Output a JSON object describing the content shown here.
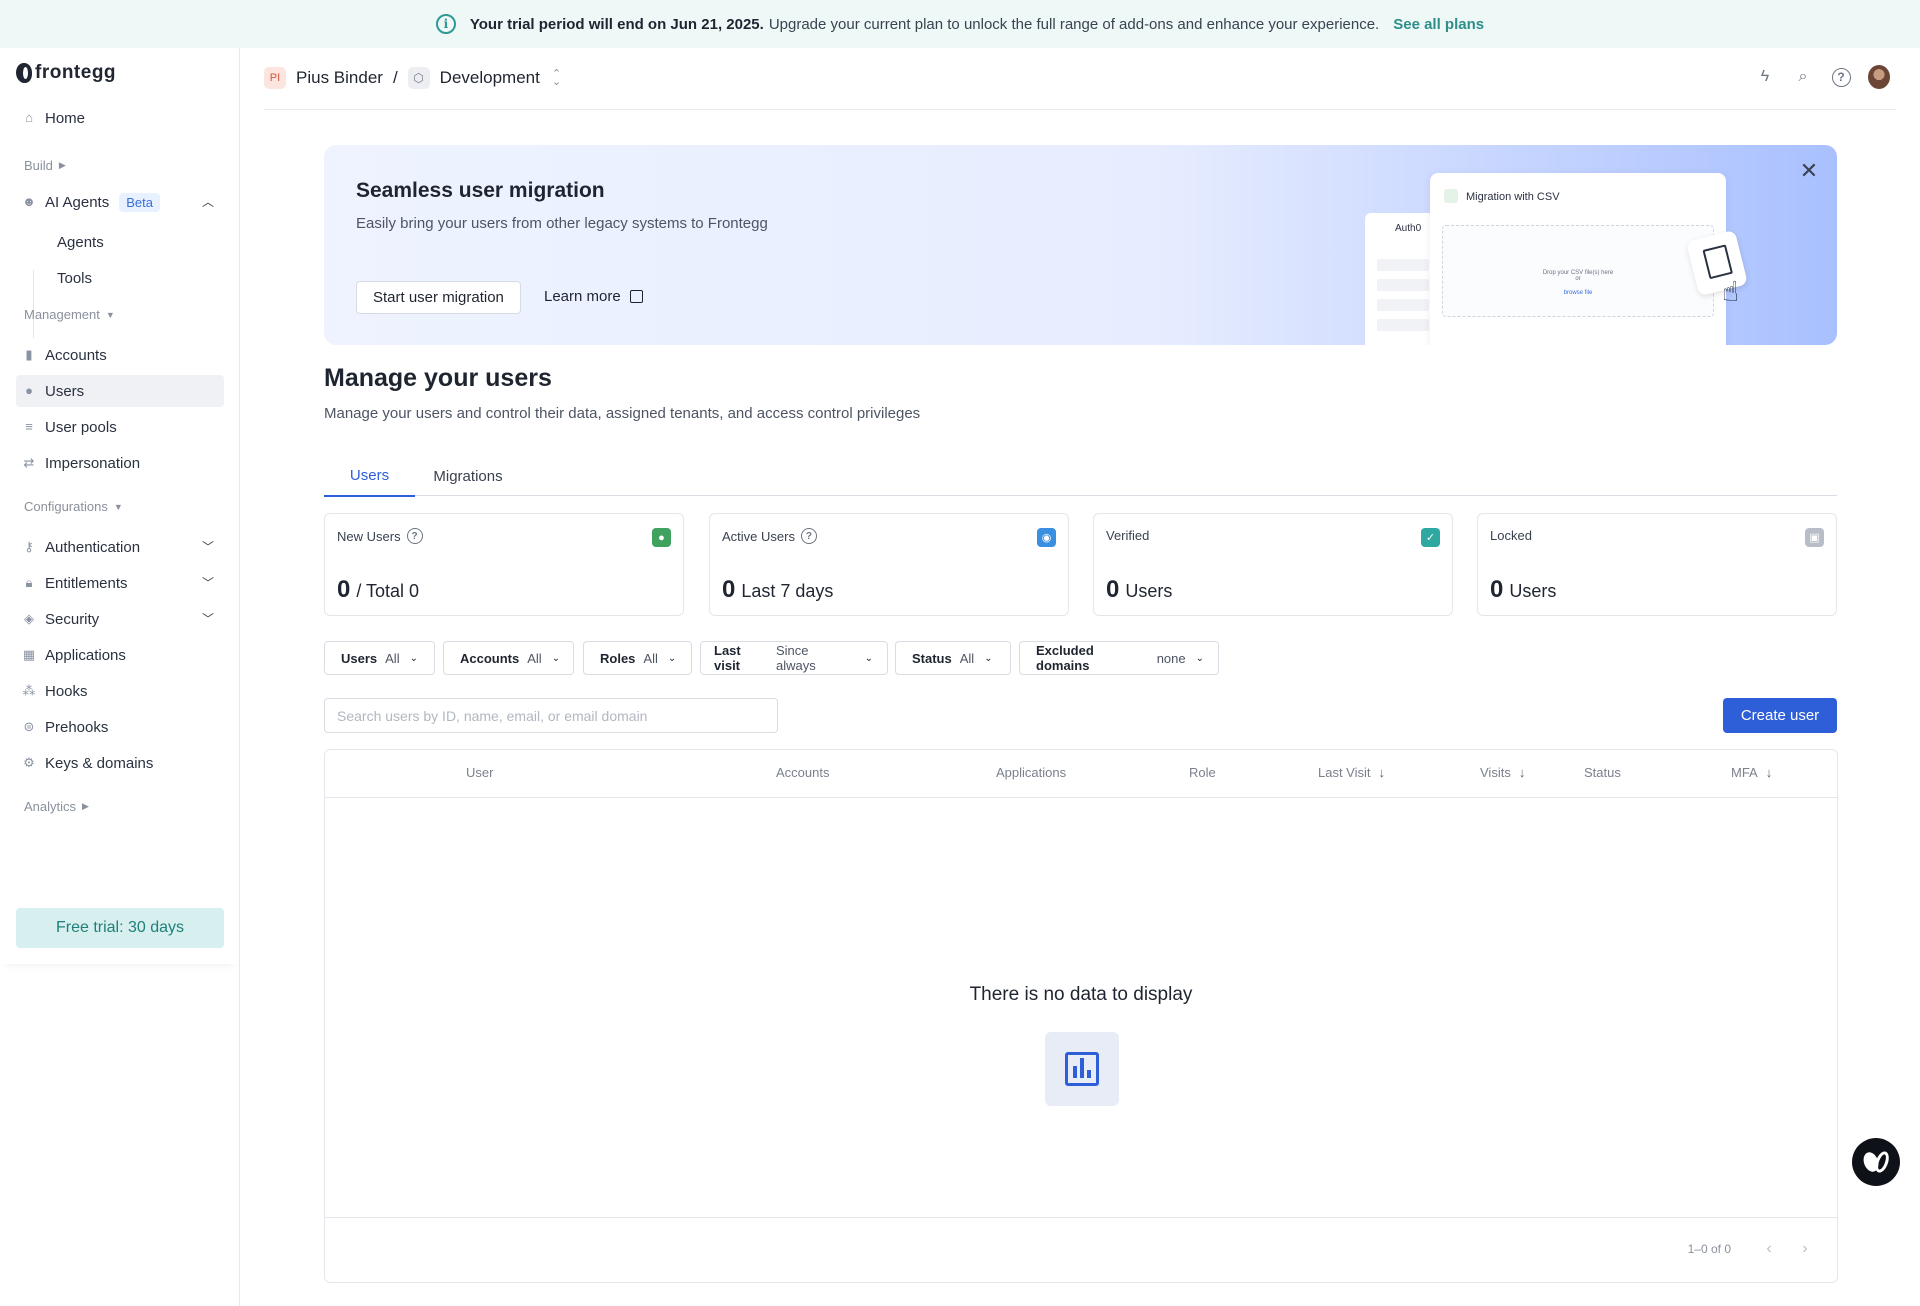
{
  "banner": {
    "bold": "Your trial period will end on Jun 21, 2025.",
    "text": "Upgrade your current plan to unlock the full range of add-ons and enhance your experience.",
    "link": "See all plans"
  },
  "sidebar": {
    "logo": "frontegg",
    "home": "Home",
    "build_label": "Build",
    "ai_agents": {
      "label": "AI Agents",
      "badge": "Beta",
      "children": [
        "Agents",
        "Tools"
      ]
    },
    "management_label": "Management",
    "management_items": [
      "Accounts",
      "Users",
      "User pools",
      "Impersonation"
    ],
    "configurations_label": "Configurations",
    "configuration_items": [
      "Authentication",
      "Entitlements",
      "Security",
      "Applications",
      "Hooks",
      "Prehooks",
      "Keys & domains"
    ],
    "analytics_label": "Analytics",
    "trial": "Free trial: 30 days",
    "active_item": "Users"
  },
  "header": {
    "workspace_initials": "PI",
    "workspace": "Pius Binder",
    "separator": "/",
    "environment": "Development"
  },
  "promo": {
    "title": "Seamless user migration",
    "subtitle": "Easily bring your users from other legacy systems to Frontegg",
    "primary": "Start user migration",
    "secondary": "Learn more",
    "mock_card_title": "Migration with CSV",
    "mock_side_title": "Auth0",
    "mock_drop_text": "Drop your CSV file(s) here",
    "mock_drop_or": "or",
    "mock_drop_link": "browse file"
  },
  "page": {
    "title": "Manage your users",
    "subtitle": "Manage your users and control their data, assigned tenants, and access control privileges"
  },
  "tabs": [
    "Users",
    "Migrations"
  ],
  "stats": [
    {
      "label": "New Users",
      "value": "0",
      "suffix": "/ Total 0",
      "color": "#3fa35f"
    },
    {
      "label": "Active Users",
      "value": "0",
      "suffix": "Last 7 days",
      "color": "#3b8fe0"
    },
    {
      "label": "Verified",
      "value": "0",
      "suffix": "Users",
      "color": "#2ea8a0"
    },
    {
      "label": "Locked",
      "value": "0",
      "suffix": "Users",
      "color": "#b8bec8"
    }
  ],
  "filters": [
    {
      "key": "Users",
      "value": "All"
    },
    {
      "key": "Accounts",
      "value": "All"
    },
    {
      "key": "Roles",
      "value": "All"
    },
    {
      "key": "Last visit",
      "value": "Since always"
    },
    {
      "key": "Status",
      "value": "All"
    },
    {
      "key": "Excluded domains",
      "value": "none"
    }
  ],
  "search": {
    "placeholder": "Search users by ID, name, email, or email domain"
  },
  "create_button": "Create user",
  "table": {
    "columns": [
      "User",
      "Accounts",
      "Applications",
      "Role",
      "Last Visit",
      "Visits",
      "Status",
      "MFA"
    ],
    "empty": "There is no data to display",
    "pagination": "1–0 of 0"
  },
  "colors": {
    "accent": "#2f5fd8",
    "teal": "#2e8e88"
  }
}
